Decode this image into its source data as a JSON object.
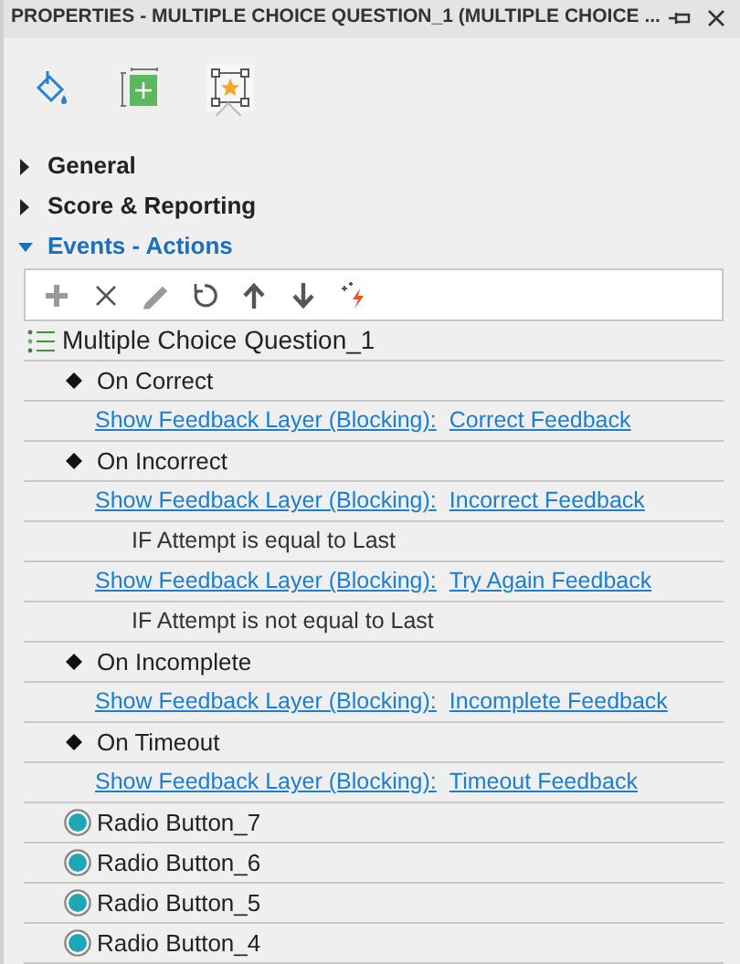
{
  "window": {
    "title": "PROPERTIES - MULTIPLE CHOICE QUESTION_1 (MULTIPLE CHOICE ..."
  },
  "tabs": [
    {
      "kind": "fill",
      "selected": false
    },
    {
      "kind": "size",
      "selected": false
    },
    {
      "kind": "action",
      "selected": true
    }
  ],
  "sections": [
    {
      "label": "General",
      "expanded": false
    },
    {
      "label": "Score & Reporting",
      "expanded": false
    },
    {
      "label": "Events - Actions",
      "expanded": true
    }
  ],
  "toolbar": [
    {
      "kind": "add",
      "disabled": true
    },
    {
      "kind": "delete",
      "disabled": false
    },
    {
      "kind": "edit",
      "disabled": true
    },
    {
      "kind": "reset",
      "disabled": false
    },
    {
      "kind": "up",
      "disabled": false
    },
    {
      "kind": "down",
      "disabled": false
    },
    {
      "kind": "trigger",
      "disabled": false
    }
  ],
  "tree": [
    {
      "kind": "root",
      "text": "Multiple Choice Question_1"
    },
    {
      "kind": "event",
      "text": "On Correct"
    },
    {
      "kind": "action",
      "action": "Show Feedback Layer (Blocking):",
      "target": "Correct Feedback"
    },
    {
      "kind": "event",
      "text": "On Incorrect"
    },
    {
      "kind": "action",
      "action": "Show Feedback Layer (Blocking):",
      "target": "Incorrect Feedback"
    },
    {
      "kind": "condition",
      "text": "IF Attempt is equal to Last"
    },
    {
      "kind": "action",
      "action": "Show Feedback Layer (Blocking):",
      "target": "Try Again Feedback"
    },
    {
      "kind": "condition",
      "text": "IF Attempt is not equal to Last"
    },
    {
      "kind": "event",
      "text": "On Incomplete"
    },
    {
      "kind": "action",
      "action": "Show Feedback Layer (Blocking):",
      "target": "Incomplete Feedback"
    },
    {
      "kind": "event",
      "text": "On Timeout"
    },
    {
      "kind": "action",
      "action": "Show Feedback Layer (Blocking):",
      "target": "Timeout Feedback"
    },
    {
      "kind": "object",
      "text": "Radio Button_7"
    },
    {
      "kind": "object",
      "text": "Radio Button_6"
    },
    {
      "kind": "object",
      "text": "Radio Button_5"
    },
    {
      "kind": "object",
      "text": "Radio Button_4"
    }
  ]
}
